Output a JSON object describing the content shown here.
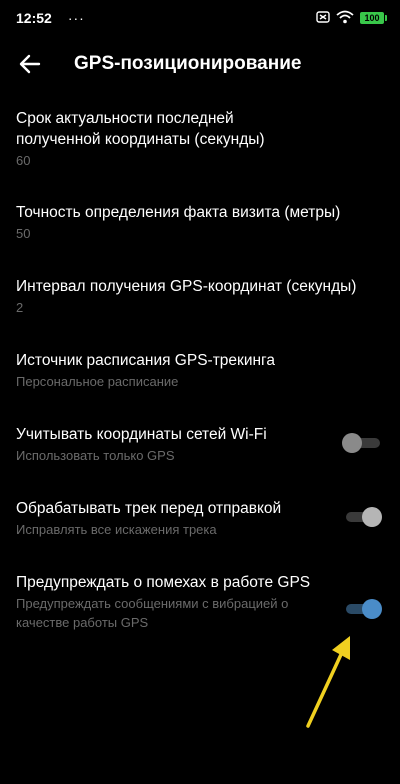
{
  "status_bar": {
    "time": "12:52",
    "more": "···",
    "battery": "100"
  },
  "header": {
    "title": "GPS-позиционирование"
  },
  "settings": [
    {
      "title": "Срок актуальности последней полученной координаты (секунды)",
      "value": "60"
    },
    {
      "title": "Точность определения факта визита (метры)",
      "value": "50"
    },
    {
      "title": "Интервал получения GPS-координат (секунды)",
      "value": "2"
    },
    {
      "title": "Источник расписания GPS-трекинга",
      "value": "Персональное расписание"
    },
    {
      "title": "Учитывать координаты сетей Wi-Fi",
      "value": "Использовать только GPS",
      "toggle": "off"
    },
    {
      "title": "Обрабатывать трек перед отправкой",
      "value": "Исправлять все искажения трека",
      "toggle": "off"
    },
    {
      "title": "Предупреждать о помехах в работе GPS",
      "value": "Предупреждать сообщениями с вибрацией о качестве работы GPS",
      "toggle": "on"
    }
  ],
  "colors": {
    "accent": "#4a8cc8",
    "annotation_arrow": "#f0d020",
    "battery": "#39c74a"
  }
}
